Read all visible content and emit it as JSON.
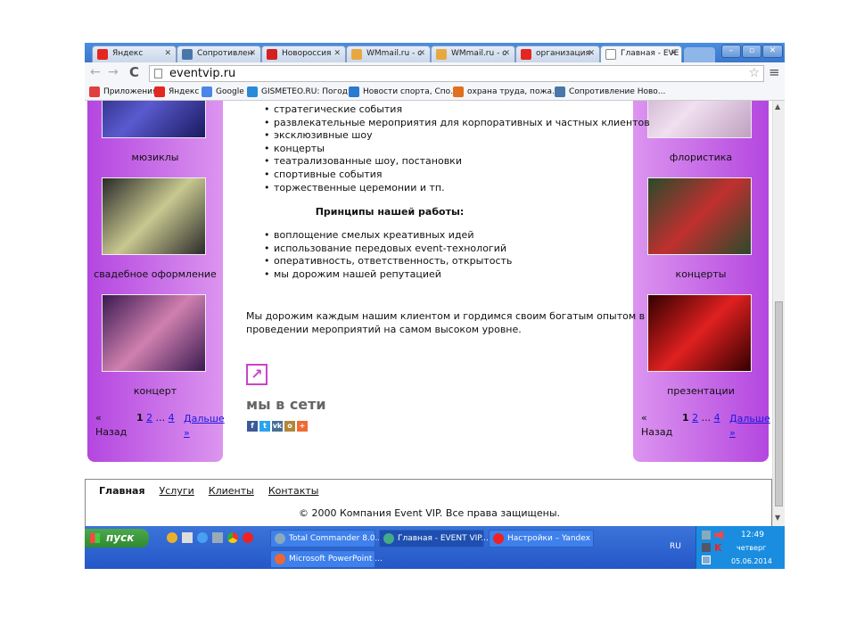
{
  "browser": {
    "tabs": [
      {
        "label": "Яндекс",
        "icon": "yandex-icon",
        "color": "#e52620"
      },
      {
        "label": "Сопротивлен",
        "icon": "vk-icon",
        "color": "#4a76a8"
      },
      {
        "label": "Новороссия",
        "icon": "news-icon",
        "color": "#d42020"
      },
      {
        "label": "WMmail.ru - c",
        "icon": "wmmail-icon",
        "color": "#e8a840"
      },
      {
        "label": "WMmail.ru - c",
        "icon": "wmmail-icon",
        "color": "#e8a840"
      },
      {
        "label": "организация",
        "icon": "yandex-icon",
        "color": "#e52620"
      },
      {
        "label": "Главная - EVE",
        "icon": "page-icon",
        "color": "#ffffff"
      }
    ],
    "url": "eventvip.ru",
    "bookmarks": [
      {
        "label": "Приложения",
        "icon": "apps-icon",
        "color": "#e04040"
      },
      {
        "label": "Яндекс",
        "icon": "yandex-icon",
        "color": "#e52620"
      },
      {
        "label": "Google",
        "icon": "google-icon",
        "color": "#4a86e8"
      },
      {
        "label": "GISMETEO.RU: Погод...",
        "icon": "gismeteo-icon",
        "color": "#2a8ad8"
      },
      {
        "label": "Новости спорта, Спо...",
        "icon": "sport-icon",
        "color": "#2a7ad0"
      },
      {
        "label": "охрана труда, пожа...",
        "icon": "safety-icon",
        "color": "#e07020"
      },
      {
        "label": "Сопротивление Ново...",
        "icon": "vk-icon",
        "color": "#4a76a8"
      }
    ]
  },
  "left_panel": {
    "items": [
      {
        "caption": "мюзиклы"
      },
      {
        "caption": "свадебное оформление"
      },
      {
        "caption": "концерт"
      }
    ],
    "pager": {
      "prev": "«",
      "prev2": "Назад",
      "current": "1",
      "p2": "2",
      "dots": "...",
      "last": "4",
      "next": "Дальше",
      "next2": "»"
    }
  },
  "right_panel": {
    "items": [
      {
        "caption": "флористика"
      },
      {
        "caption": "концерты"
      },
      {
        "caption": "презентации"
      }
    ],
    "pager": {
      "prev": "«",
      "prev2": "Назад",
      "current": "1",
      "p2": "2",
      "dots": "...",
      "last": "4",
      "next": "Дальше",
      "next2": "»"
    }
  },
  "main": {
    "list1": [
      "стратегические события",
      "развлекательные  мероприятия для корпоративных и частных клиентов",
      "эксклюзивные  шоу",
      "концерты",
      "театрализованные  шоу, постановки",
      "спортивные события",
      "торжественные  церемонии и тп."
    ],
    "heading": "Принципы  нашей работы:",
    "list2": [
      "воплощение смелых креативных  идей",
      "использование передовых  event-технологий",
      "оперативность, ответственность, открытость",
      "мы дорожим нашей репутацией"
    ],
    "para1": "Мы дорожим  каждым  нашим  клиентом и гордимся  своим богатым опытом в",
    "para2": "проведении мероприятий  на самом высоком  уровне.",
    "social_title": "мы в сети",
    "social": [
      {
        "icon": "facebook-icon",
        "label": "f",
        "color": "#3b5998"
      },
      {
        "icon": "twitter-icon",
        "label": "t",
        "color": "#2aa3ef"
      },
      {
        "icon": "vk-icon",
        "label": "vk",
        "color": "#4a6e94"
      },
      {
        "icon": "odnoklassniki-icon",
        "label": "o",
        "color": "#b0873a"
      },
      {
        "icon": "more-icon",
        "label": "+",
        "color": "#f06a35"
      }
    ]
  },
  "footer": {
    "nav": [
      "Главная",
      "Услуги",
      "Клиенты",
      "Контакты"
    ],
    "copyright": "© 2000 Компания Event VIP. Все права защищены."
  },
  "taskbar": {
    "start": "пуск",
    "tasks": [
      "Total Commander 8.0...",
      "Главная - EVENT VIP...",
      "Настройки – Yandex",
      "Microsoft PowerPoint ..."
    ],
    "lang": "RU",
    "time": "12:49",
    "day": "четверг",
    "date": "05.06.2014"
  }
}
